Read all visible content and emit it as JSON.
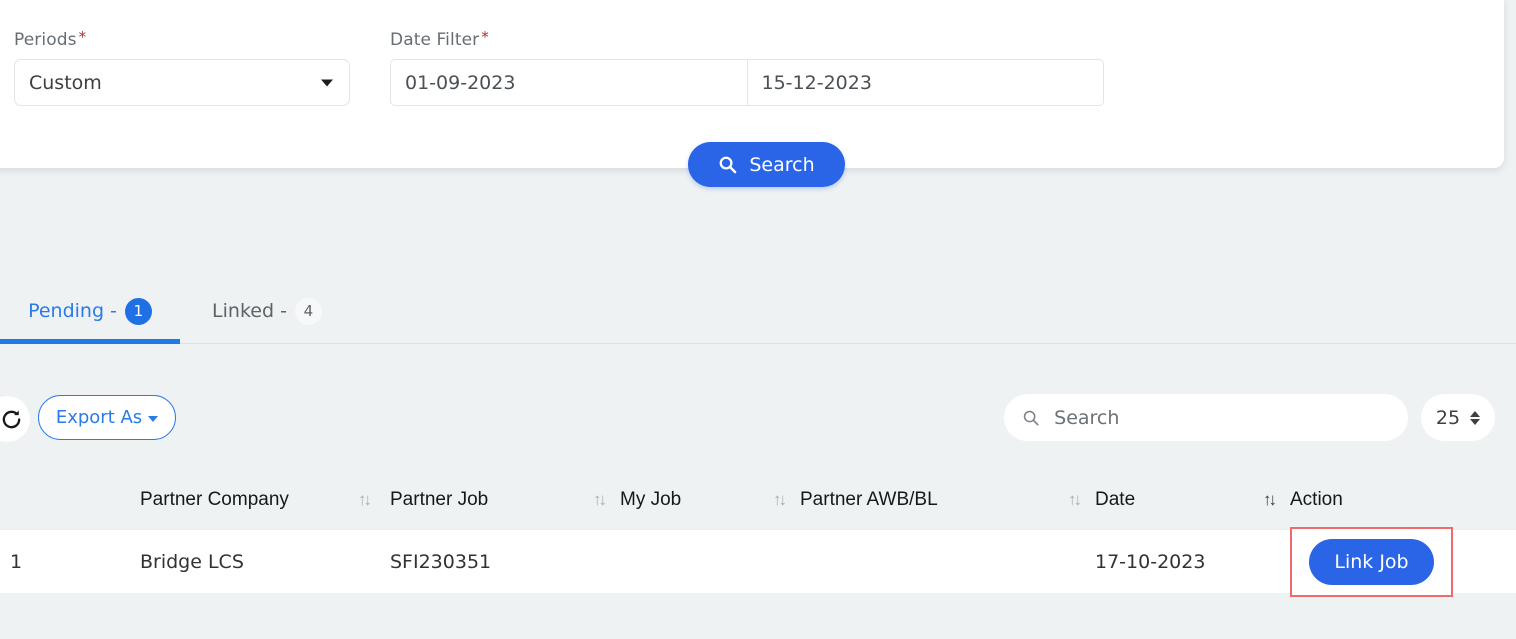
{
  "filters": {
    "periods": {
      "label": "Periods",
      "required_mark": "*",
      "value": "Custom",
      "caret_icon": "chevron-down-icon"
    },
    "date_filter": {
      "label": "Date Filter",
      "required_mark": "*",
      "from": "01-09-2023",
      "to": "15-12-2023"
    },
    "search_button": {
      "label": "Search",
      "icon": "search-icon"
    }
  },
  "tabs": [
    {
      "label": "Pending -",
      "count": "1",
      "active": true
    },
    {
      "label": "Linked -",
      "count": "4",
      "active": false
    }
  ],
  "toolbar": {
    "refresh_icon": "refresh-icon",
    "export_label": "Export As",
    "export_caret": "caret-down-icon",
    "search_placeholder": "Search",
    "search_value": "",
    "search_icon": "search-icon",
    "page_size": "25"
  },
  "table": {
    "columns": [
      {
        "label": "Partner Company",
        "sortable": true,
        "sort_active": false
      },
      {
        "label": "Partner Job",
        "sortable": true,
        "sort_active": false
      },
      {
        "label": "My Job",
        "sortable": true,
        "sort_active": false
      },
      {
        "label": "Partner AWB/BL",
        "sortable": true,
        "sort_active": false
      },
      {
        "label": "Date",
        "sortable": true,
        "sort_active": true
      },
      {
        "label": "Action",
        "sortable": false,
        "sort_active": false
      }
    ],
    "sort_glyph": "↑↓",
    "rows": [
      {
        "index": "1",
        "partner_company": "Bridge LCS",
        "partner_job": "SFI230351",
        "my_job": "",
        "partner_awb_bl": "",
        "date": "17-10-2023",
        "action_label": "Link Job"
      }
    ]
  },
  "colors": {
    "accent_blue": "#2a65e8",
    "tab_blue": "#2a7ae8",
    "highlight_red": "#ef6b6b",
    "page_bg": "#eef2f3",
    "required_red": "#a5332c"
  }
}
